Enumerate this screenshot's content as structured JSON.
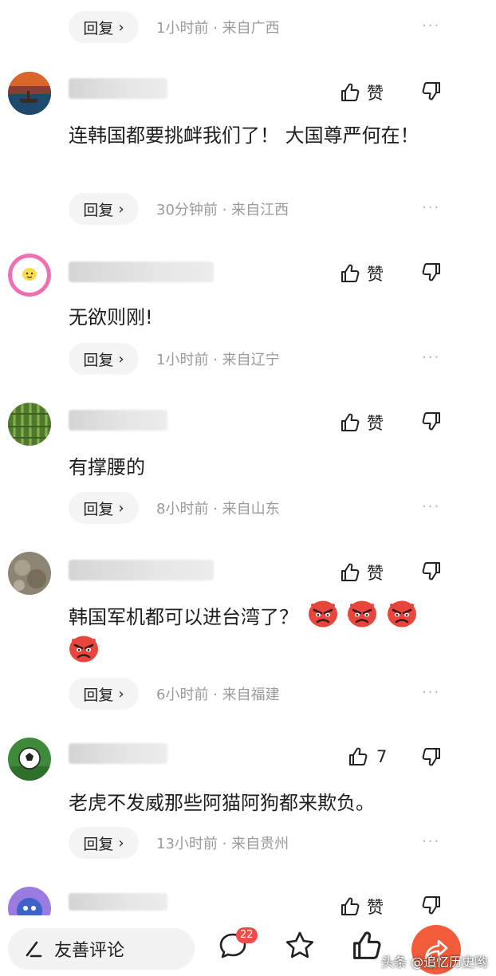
{
  "comments": [
    {
      "reply_label": "回复",
      "time": "1小时前",
      "location": "来自广西"
    },
    {
      "text": "连韩国都要挑衅我们了！ 大国尊严何在！",
      "like_label": "赞",
      "reply_label": "回复",
      "time": "30分钟前",
      "location": "来自江西"
    },
    {
      "text": "无欲则刚!",
      "like_label": "赞",
      "reply_label": "回复",
      "time": "1小时前",
      "location": "来自辽宁"
    },
    {
      "text": "有撑腰的",
      "like_label": "赞",
      "reply_label": "回复",
      "time": "8小时前",
      "location": "来自山东"
    },
    {
      "text": "韩国军机都可以进台湾了？",
      "emoji_count": 4,
      "emoji_icon": "angry-face-icon",
      "like_label": "赞",
      "reply_label": "回复",
      "time": "6小时前",
      "location": "来自福建"
    },
    {
      "text": "老虎不发威那些阿猫阿狗都来欺负。",
      "like_count": "7",
      "reply_label": "回复",
      "time": "13小时前",
      "location": "来自贵州"
    },
    {
      "like_label": "赞"
    }
  ],
  "meta_separator": "·",
  "more_label": "···",
  "reply_chevron": "›",
  "bottom_bar": {
    "friendly_comment_label": "友善评论",
    "comment_badge": "22",
    "watermark": "头条 @追忆历史哟"
  },
  "colors": {
    "badge": "#f04b4b",
    "share_button": "#f35c3a",
    "meta_text": "#9a9a9a"
  }
}
